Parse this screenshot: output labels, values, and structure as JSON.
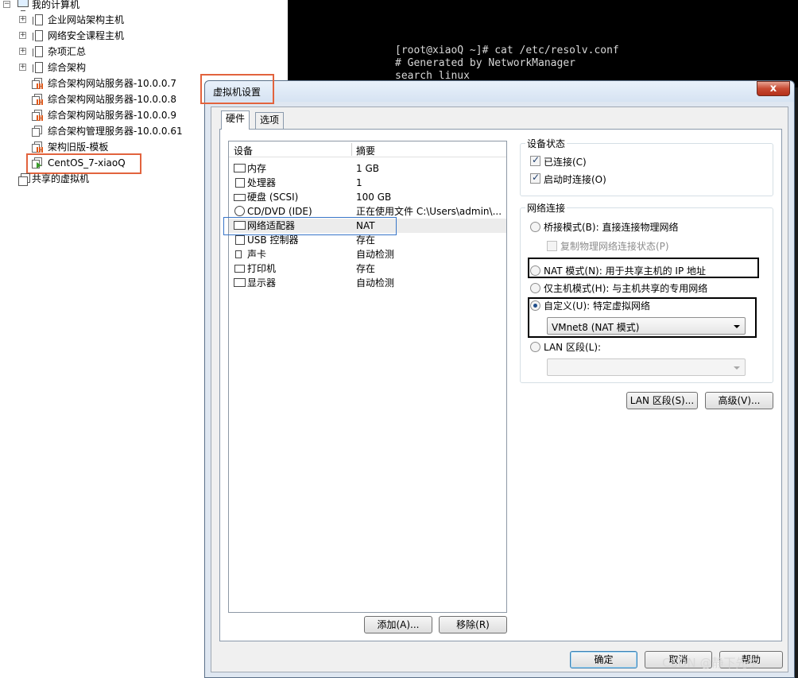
{
  "tree": {
    "root": "我的计算机",
    "items": [
      {
        "label": "企业网站架构主机",
        "type": "folder"
      },
      {
        "label": "网络安全课程主机",
        "type": "folder"
      },
      {
        "label": "杂项汇总",
        "type": "folder"
      },
      {
        "label": "综合架构",
        "type": "folder"
      },
      {
        "label": "综合架构网站服务器-10.0.0.7",
        "type": "vm-stopped"
      },
      {
        "label": "综合架构网站服务器-10.0.0.8",
        "type": "vm-stopped"
      },
      {
        "label": "综合架构网站服务器-10.0.0.9",
        "type": "vm-stopped"
      },
      {
        "label": "综合架构管理服务器-10.0.0.61",
        "type": "vm-stopped"
      },
      {
        "label": "架构旧版-模板",
        "type": "vm-stopped"
      },
      {
        "label": "CentOS_7-xiaoQ",
        "type": "vm-running"
      }
    ],
    "shared": "共享的虚拟机"
  },
  "terminal": {
    "lines": [
      "[root@xiaoQ ~]# cat /etc/resolv.conf",
      "# Generated by NetworkManager",
      "search linux"
    ]
  },
  "dialog": {
    "title": "虚拟机设置",
    "close": "x",
    "tabs": [
      "硬件",
      "选项"
    ],
    "device_list": {
      "headers": [
        "设备",
        "摘要"
      ],
      "rows": [
        {
          "name": "内存",
          "summary": "1 GB",
          "icon": "memory-icon"
        },
        {
          "name": "处理器",
          "summary": "1",
          "icon": "cpu-icon"
        },
        {
          "name": "硬盘 (SCSI)",
          "summary": "100 GB",
          "icon": "harddisk-icon"
        },
        {
          "name": "CD/DVD (IDE)",
          "summary": "正在使用文件 C:\\Users\\admin\\...",
          "icon": "cdrom-icon"
        },
        {
          "name": "网络适配器",
          "summary": "NAT",
          "icon": "network-adapter-icon"
        },
        {
          "name": "USB 控制器",
          "summary": "存在",
          "icon": "usb-icon"
        },
        {
          "name": "声卡",
          "summary": "自动检测",
          "icon": "speaker-icon"
        },
        {
          "name": "打印机",
          "summary": "存在",
          "icon": "printer-icon"
        },
        {
          "name": "显示器",
          "summary": "自动检测",
          "icon": "monitor-icon"
        }
      ]
    },
    "add_button": "添加(A)...",
    "remove_button": "移除(R)",
    "device_status": {
      "title": "设备状态",
      "connected": "已连接(C)",
      "connect_at_power_on": "启动时连接(O)"
    },
    "network": {
      "title": "网络连接",
      "bridged": "桥接模式(B): 直接连接物理网络",
      "replicate": "复制物理网络连接状态(P)",
      "nat": "NAT 模式(N): 用于共享主机的 IP 地址",
      "hostonly": "仅主机模式(H): 与主机共享的专用网络",
      "custom": "自定义(U): 特定虚拟网络",
      "custom_value": "VMnet8 (NAT 模式)",
      "lan": "LAN 区段(L):",
      "lan_value": "",
      "selected": "custom"
    },
    "lan_segments_button": "LAN 区段(S)...",
    "advanced_button": "高级(V)...",
    "ok_button": "确定",
    "cancel_button": "取消",
    "help_button": "帮助"
  },
  "watermark": "CSDN @静下先生"
}
